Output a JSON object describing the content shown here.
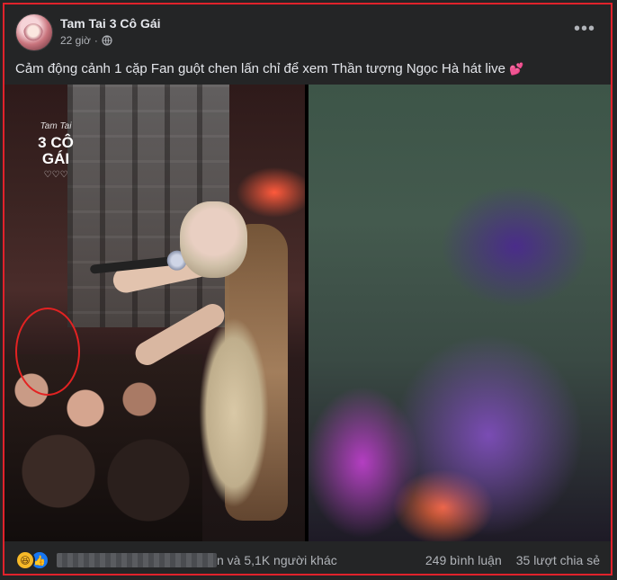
{
  "post": {
    "page_name": "Tam Tai 3 Cô Gái",
    "time": "22 giờ",
    "privacy_icon": "globe-icon",
    "more_icon": "more-options-icon",
    "text": "Cảm động cảnh 1 cặp Fan guột chen lấn chỉ để xem Thần tượng Ngọc Hà hát live",
    "emoji": "💕"
  },
  "media": {
    "watermark_small": "Tam Tai",
    "watermark_main": "3 CÔ GÁI",
    "watermark_hearts": "♡♡♡"
  },
  "reactions": {
    "icons": [
      "haha-icon",
      "like-icon"
    ],
    "others_text": "n và 5,1K người khác",
    "comments": "249 bình luận",
    "shares": "35 lượt chia sẻ"
  },
  "colors": {
    "background": "#242526",
    "frame_border": "#e0222b",
    "text_primary": "#e4e6eb",
    "text_secondary": "#b0b3b8",
    "like_blue": "#1877f2",
    "haha_yellow": "#f7b928"
  }
}
